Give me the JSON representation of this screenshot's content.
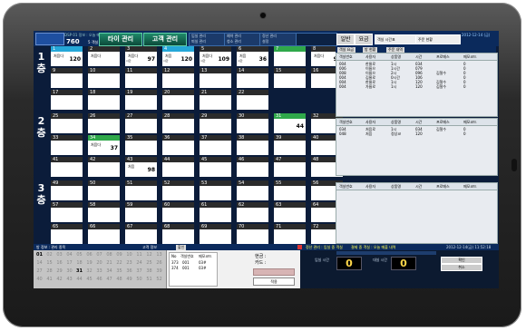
{
  "header": {
    "small_text": "DSP 01 정보 : 오늘 매출 현황",
    "main_count": "760",
    "sub_count": "5 객실",
    "btn1": "타이 관리",
    "btn2": "고객 관리",
    "mini": [
      "입실 관리",
      "퇴실 관리",
      "예약 관리",
      "청소 관리",
      "정산 관리",
      "설정"
    ],
    "mode_btn": "일반",
    "mode_btn2": "요금",
    "select1": "객실 시간표",
    "select2": "주문 현황",
    "right_info": "2012-12-14 (금)"
  },
  "floors": [
    {
      "label": "1층",
      "rooms": [
        {
          "no": "1",
          "style": "c",
          "name": "처음다",
          "time": "",
          "value": "120",
          "tag": ""
        },
        {
          "no": "2",
          "style": "",
          "name": "처음다",
          "time": "",
          "value": "",
          "tag": ""
        },
        {
          "no": "3",
          "style": "",
          "name": "처음다",
          "time": "",
          "value": "97",
          "tag": "시간"
        },
        {
          "no": "4",
          "style": "c",
          "name": "처음",
          "time": "",
          "value": "120",
          "tag": "시간"
        },
        {
          "no": "5",
          "style": "",
          "name": "처음다",
          "time": "",
          "value": "109",
          "tag": "시간"
        },
        {
          "no": "6",
          "style": "",
          "name": "처음",
          "time": "",
          "value": "36",
          "tag": "시간"
        },
        {
          "no": "7",
          "style": "g",
          "name": "",
          "time": "",
          "value": "",
          "tag": ""
        },
        {
          "no": "8",
          "style": "",
          "name": "처음다",
          "time": "",
          "value": "91",
          "tag": ""
        },
        {
          "no": "9",
          "style": "",
          "name": "",
          "time": "",
          "value": "",
          "tag": ""
        },
        {
          "no": "10",
          "style": "",
          "name": "",
          "time": "",
          "value": "",
          "tag": ""
        },
        {
          "no": "11",
          "style": "",
          "name": "",
          "time": "",
          "value": "",
          "tag": ""
        },
        {
          "no": "12",
          "style": "",
          "name": "",
          "time": "",
          "value": "",
          "tag": ""
        },
        {
          "no": "13",
          "style": "",
          "name": "",
          "time": "",
          "value": "",
          "tag": ""
        },
        {
          "no": "14",
          "style": "",
          "name": "",
          "time": "",
          "value": "",
          "tag": ""
        },
        {
          "no": "15",
          "style": "",
          "name": "",
          "time": "",
          "value": "",
          "tag": ""
        },
        {
          "no": "16",
          "style": "",
          "name": "",
          "time": "",
          "value": "",
          "tag": ""
        },
        {
          "no": "17",
          "style": "",
          "name": "",
          "time": "",
          "value": "",
          "tag": ""
        },
        {
          "no": "18",
          "style": "",
          "name": "",
          "time": "",
          "value": "",
          "tag": ""
        },
        {
          "no": "19",
          "style": "",
          "name": "",
          "time": "",
          "value": "",
          "tag": ""
        },
        {
          "no": "20",
          "style": "",
          "name": "",
          "time": "",
          "value": "",
          "tag": ""
        },
        {
          "no": "21",
          "style": "",
          "name": "",
          "time": "",
          "value": "",
          "tag": ""
        },
        {
          "no": "22",
          "style": "",
          "name": "",
          "time": "",
          "value": "",
          "tag": ""
        },
        {
          "no": "23",
          "style": "",
          "name": "",
          "time": "",
          "value": "",
          "tag": ""
        },
        {
          "no": "24",
          "style": "",
          "name": "",
          "time": "",
          "value": "",
          "tag": ""
        }
      ]
    },
    {
      "label": "2층",
      "rooms": [
        {
          "no": "25",
          "style": "",
          "name": "",
          "time": "",
          "value": "",
          "tag": ""
        },
        {
          "no": "26",
          "style": "",
          "name": "",
          "time": "",
          "value": "",
          "tag": ""
        },
        {
          "no": "27",
          "style": "",
          "name": "",
          "time": "",
          "value": "",
          "tag": ""
        },
        {
          "no": "28",
          "style": "",
          "name": "",
          "time": "",
          "value": "",
          "tag": ""
        },
        {
          "no": "29",
          "style": "",
          "name": "",
          "time": "",
          "value": "",
          "tag": ""
        },
        {
          "no": "30",
          "style": "",
          "name": "",
          "time": "",
          "value": "",
          "tag": ""
        },
        {
          "no": "31",
          "style": "g",
          "name": "",
          "time": "",
          "value": "44",
          "tag": ""
        },
        {
          "no": "32",
          "style": "",
          "name": "",
          "time": "",
          "value": "",
          "tag": ""
        },
        {
          "no": "33",
          "style": "",
          "name": "",
          "time": "",
          "value": "",
          "tag": ""
        },
        {
          "no": "34",
          "style": "g",
          "name": "처음다",
          "time": "",
          "value": "37",
          "tag": ""
        },
        {
          "no": "35",
          "style": "",
          "name": "",
          "time": "",
          "value": "",
          "tag": ""
        },
        {
          "no": "36",
          "style": "",
          "name": "",
          "time": "",
          "value": "",
          "tag": ""
        },
        {
          "no": "37",
          "style": "",
          "name": "",
          "time": "",
          "value": "",
          "tag": ""
        },
        {
          "no": "38",
          "style": "",
          "name": "",
          "time": "",
          "value": "",
          "tag": ""
        },
        {
          "no": "39",
          "style": "",
          "name": "",
          "time": "",
          "value": "",
          "tag": ""
        },
        {
          "no": "40",
          "style": "",
          "name": "",
          "time": "",
          "value": "",
          "tag": ""
        },
        {
          "no": "41",
          "style": "",
          "name": "",
          "time": "",
          "value": "",
          "tag": ""
        },
        {
          "no": "42",
          "style": "",
          "name": "",
          "time": "",
          "value": "",
          "tag": ""
        },
        {
          "no": "43",
          "style": "",
          "name": "처음",
          "time": "",
          "value": "98",
          "tag": ""
        },
        {
          "no": "44",
          "style": "",
          "name": "",
          "time": "",
          "value": "",
          "tag": ""
        },
        {
          "no": "45",
          "style": "",
          "name": "",
          "time": "",
          "value": "",
          "tag": ""
        },
        {
          "no": "46",
          "style": "",
          "name": "",
          "time": "",
          "value": "",
          "tag": ""
        },
        {
          "no": "47",
          "style": "",
          "name": "",
          "time": "",
          "value": "",
          "tag": ""
        },
        {
          "no": "48",
          "style": "",
          "name": "",
          "time": "",
          "value": "",
          "tag": ""
        }
      ]
    },
    {
      "label": "3층",
      "rooms": [
        {
          "no": "49",
          "style": "",
          "name": "",
          "time": "",
          "value": "",
          "tag": ""
        },
        {
          "no": "50",
          "style": "",
          "name": "",
          "time": "",
          "value": "",
          "tag": ""
        },
        {
          "no": "51",
          "style": "",
          "name": "",
          "time": "",
          "value": "",
          "tag": ""
        },
        {
          "no": "52",
          "style": "",
          "name": "",
          "time": "",
          "value": "",
          "tag": ""
        },
        {
          "no": "53",
          "style": "",
          "name": "",
          "time": "",
          "value": "",
          "tag": ""
        },
        {
          "no": "54",
          "style": "",
          "name": "",
          "time": "",
          "value": "",
          "tag": ""
        },
        {
          "no": "55",
          "style": "",
          "name": "",
          "time": "",
          "value": "",
          "tag": ""
        },
        {
          "no": "56",
          "style": "",
          "name": "",
          "time": "",
          "value": "",
          "tag": ""
        },
        {
          "no": "57",
          "style": "",
          "name": "",
          "time": "",
          "value": "",
          "tag": ""
        },
        {
          "no": "58",
          "style": "",
          "name": "",
          "time": "",
          "value": "",
          "tag": ""
        },
        {
          "no": "59",
          "style": "",
          "name": "",
          "time": "",
          "value": "",
          "tag": ""
        },
        {
          "no": "60",
          "style": "",
          "name": "",
          "time": "",
          "value": "",
          "tag": ""
        },
        {
          "no": "61",
          "style": "",
          "name": "",
          "time": "",
          "value": "",
          "tag": ""
        },
        {
          "no": "62",
          "style": "",
          "name": "",
          "time": "",
          "value": "",
          "tag": ""
        },
        {
          "no": "63",
          "style": "",
          "name": "",
          "time": "",
          "value": "",
          "tag": ""
        },
        {
          "no": "64",
          "style": "",
          "name": "",
          "time": "",
          "value": "",
          "tag": ""
        },
        {
          "no": "65",
          "style": "",
          "name": "",
          "time": "",
          "value": "",
          "tag": ""
        },
        {
          "no": "66",
          "style": "",
          "name": "",
          "time": "",
          "value": "",
          "tag": ""
        },
        {
          "no": "67",
          "style": "",
          "name": "",
          "time": "",
          "value": "",
          "tag": ""
        },
        {
          "no": "68",
          "style": "",
          "name": "",
          "time": "",
          "value": "",
          "tag": ""
        },
        {
          "no": "69",
          "style": "",
          "name": "",
          "time": "",
          "value": "",
          "tag": ""
        },
        {
          "no": "70",
          "style": "",
          "name": "",
          "time": "",
          "value": "",
          "tag": ""
        },
        {
          "no": "71",
          "style": "",
          "name": "",
          "time": "",
          "value": "",
          "tag": ""
        },
        {
          "no": "72",
          "style": "",
          "name": "",
          "time": "",
          "value": "",
          "tag": ""
        }
      ]
    }
  ],
  "panel_tabs": [
    "객실 요금",
    "방 현황",
    "주문 내역"
  ],
  "table_headers": [
    "객실번호",
    "사용자",
    "상품명",
    "시간",
    "프로메스",
    "메모코드"
  ],
  "table1_rows": [
    [
      "004",
      "한물로",
      "1시",
      "034",
      "",
      "0"
    ],
    [
      "006",
      "이름으",
      "1시간",
      "079",
      "",
      "0"
    ],
    [
      "008",
      "이름으",
      "2시",
      "096",
      "김철수",
      "0"
    ],
    [
      "004",
      "김물로",
      "0시간",
      "106",
      "",
      "0"
    ],
    [
      "004",
      "한물로",
      "1시",
      "120",
      "김철수",
      "0"
    ],
    [
      "004",
      "가름로",
      "1시",
      "120",
      "김철수",
      "0"
    ]
  ],
  "table2_rows": [
    [
      "034",
      "처음로",
      "1시",
      "034",
      "김철수",
      "0"
    ],
    [
      "048",
      "처음",
      "정상코",
      "120",
      "",
      "0"
    ]
  ],
  "bottom_bar": {
    "left_label": "방 정보 : 관리 종목",
    "mid_label": "고객 정보",
    "mid_tab": "할인",
    "right_label": "정산 관리 : 입실 중 객실",
    "warn": "결제 중 객실 : 오늘 매출 내역",
    "datetime": "2012-12-14(금) 11:52:18"
  },
  "day_numbers": {
    "row1": [
      "01",
      "02",
      "03",
      "04",
      "05",
      "06",
      "07",
      "08",
      "09",
      "10",
      "11",
      "12",
      "13"
    ],
    "row2": [
      "14",
      "15",
      "16",
      "17",
      "18",
      "19",
      "20",
      "21",
      "22",
      "23",
      "24",
      "25",
      "26"
    ],
    "row3": [
      "27",
      "28",
      "29",
      "30",
      "31",
      "32",
      "33",
      "34",
      "35",
      "36",
      "37",
      "38",
      "39"
    ],
    "row4": [
      "40",
      "41",
      "42",
      "43",
      "44",
      "45",
      "46",
      "47",
      "48",
      "49",
      "50",
      "51",
      "52"
    ]
  },
  "mid_info": {
    "list1": [
      "No",
      "객실번호",
      "메모코드"
    ],
    "r1": [
      "373",
      "001",
      "03#"
    ],
    "r2": [
      "374",
      "001",
      "03#"
    ],
    "label_a": "현금 :",
    "label_b": "카드 :",
    "btn": "적용"
  },
  "counters": {
    "label1": "입실 시간",
    "val1": "0",
    "label2": "대실 시간",
    "val2": "0",
    "btn_a": "확인",
    "btn_b": "취소"
  }
}
